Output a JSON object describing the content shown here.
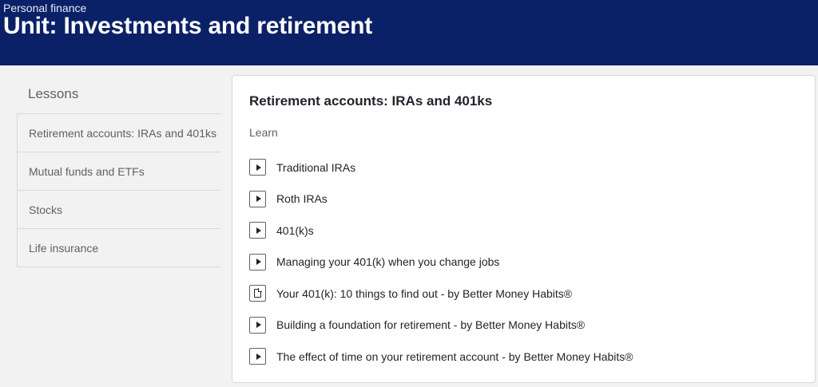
{
  "header": {
    "breadcrumb": "Personal finance",
    "title": "Unit: Investments and retirement",
    "background_color": "#0b2167"
  },
  "sidebar": {
    "heading": "Lessons",
    "items": [
      {
        "label": "Retirement accounts: IRAs and 401ks",
        "active": true
      },
      {
        "label": "Mutual funds and ETFs",
        "active": false
      },
      {
        "label": "Stocks",
        "active": false
      },
      {
        "label": "Life insurance",
        "active": false
      }
    ]
  },
  "lesson": {
    "title": "Retirement accounts: IRAs and 401ks",
    "section_label": "Learn",
    "items": [
      {
        "label": "Traditional IRAs",
        "icon": "video-icon"
      },
      {
        "label": "Roth IRAs",
        "icon": "video-icon"
      },
      {
        "label": "401(k)s",
        "icon": "video-icon"
      },
      {
        "label": "Managing your 401(k) when you change jobs",
        "icon": "video-icon"
      },
      {
        "label": "Your 401(k): 10 things to find out - by Better Money Habits®",
        "icon": "article-icon"
      },
      {
        "label": "Building a foundation for retirement - by Better Money Habits®",
        "icon": "video-icon"
      },
      {
        "label": "The effect of time on your retirement account - by Better Money Habits®",
        "icon": "video-icon"
      }
    ]
  }
}
